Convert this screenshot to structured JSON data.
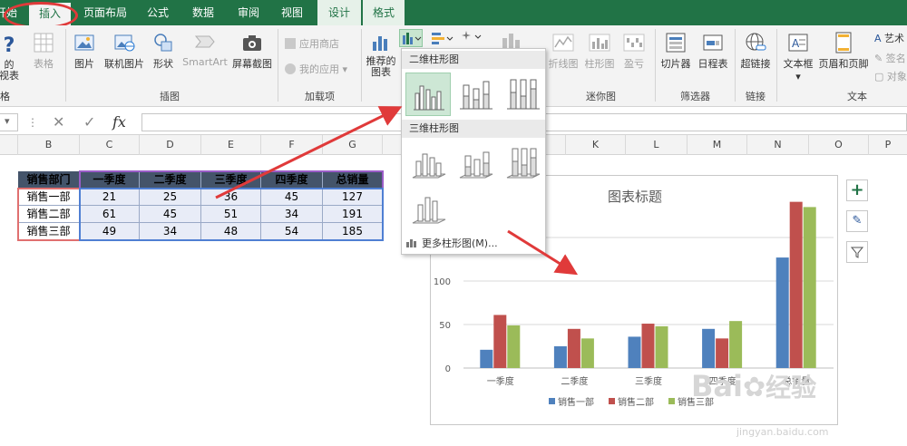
{
  "tabs": [
    {
      "label": "开始",
      "shown": "开始",
      "state": "partial"
    },
    {
      "label": "插入",
      "state": "active"
    },
    {
      "label": "页面布局"
    },
    {
      "label": "公式"
    },
    {
      "label": "数据"
    },
    {
      "label": "审阅"
    },
    {
      "label": "视图"
    },
    {
      "label": "设计",
      "state": "context"
    },
    {
      "label": "格式",
      "state": "context"
    }
  ],
  "ribbon": {
    "left_partial_label": "的\n视表",
    "table_label": "表格",
    "illus": {
      "picture": "图片",
      "online_picture": "联机图片",
      "shapes": "形状",
      "smartart": "SmartArt",
      "screenshot": "屏幕截图"
    },
    "group_illus": "插图",
    "addins": {
      "store": "应用商店",
      "myapps": "我的应用"
    },
    "group_addins": "加载项",
    "recommended_charts": "推荐的\n图表",
    "sparklines": {
      "line": "折线图",
      "column": "柱形图",
      "winloss": "盈亏"
    },
    "group_sparklines": "迷你图",
    "filters": {
      "slicer": "切片器",
      "timeline": "日程表"
    },
    "group_filters": "筛选器",
    "hyperlink": "超链接",
    "group_links": "链接",
    "text": {
      "textbox": "文本框",
      "header_footer": "页眉和页脚",
      "art": "艺术",
      "sign": "签名",
      "object": "对象"
    },
    "group_text": "文本"
  },
  "dropdown": {
    "section2d": "二维柱形图",
    "section3d": "三维柱形图",
    "more": "更多柱形图(M)..."
  },
  "columns": [
    "B",
    "C",
    "D",
    "E",
    "F",
    "G",
    "H",
    "I",
    "J",
    "K",
    "L",
    "M",
    "N",
    "O",
    "P"
  ],
  "table": {
    "headers": [
      "销售部门",
      "一季度",
      "二季度",
      "三季度",
      "四季度",
      "总销量"
    ],
    "rows": [
      {
        "dept": "销售一部",
        "values": [
          "21",
          "25",
          "36",
          "45",
          "127"
        ]
      },
      {
        "dept": "销售二部",
        "values": [
          "61",
          "45",
          "51",
          "34",
          "191"
        ]
      },
      {
        "dept": "销售三部",
        "values": [
          "49",
          "34",
          "48",
          "54",
          "185"
        ]
      }
    ]
  },
  "chart_data": {
    "type": "bar",
    "title": "图表标题",
    "categories": [
      "一季度",
      "二季度",
      "三季度",
      "四季度",
      "总销量"
    ],
    "series": [
      {
        "name": "销售一部",
        "values": [
          21,
          25,
          36,
          45,
          127
        ],
        "color": "#4f81bd"
      },
      {
        "name": "销售二部",
        "values": [
          61,
          45,
          51,
          34,
          191
        ],
        "color": "#c0504d"
      },
      {
        "name": "销售三部",
        "values": [
          49,
          34,
          48,
          54,
          185
        ],
        "color": "#9bbb59"
      }
    ],
    "ylim": [
      0,
      200
    ],
    "yticks": [
      0,
      50,
      100,
      150
    ],
    "grid": true,
    "legend": "bottom"
  },
  "watermark": {
    "brand": "Bai",
    "brand2": "经验",
    "url": "jingyan.baidu.com"
  },
  "colors": {
    "excel_green": "#217346",
    "annotation_red": "#e03a3a",
    "header_dark": "#44546a"
  }
}
